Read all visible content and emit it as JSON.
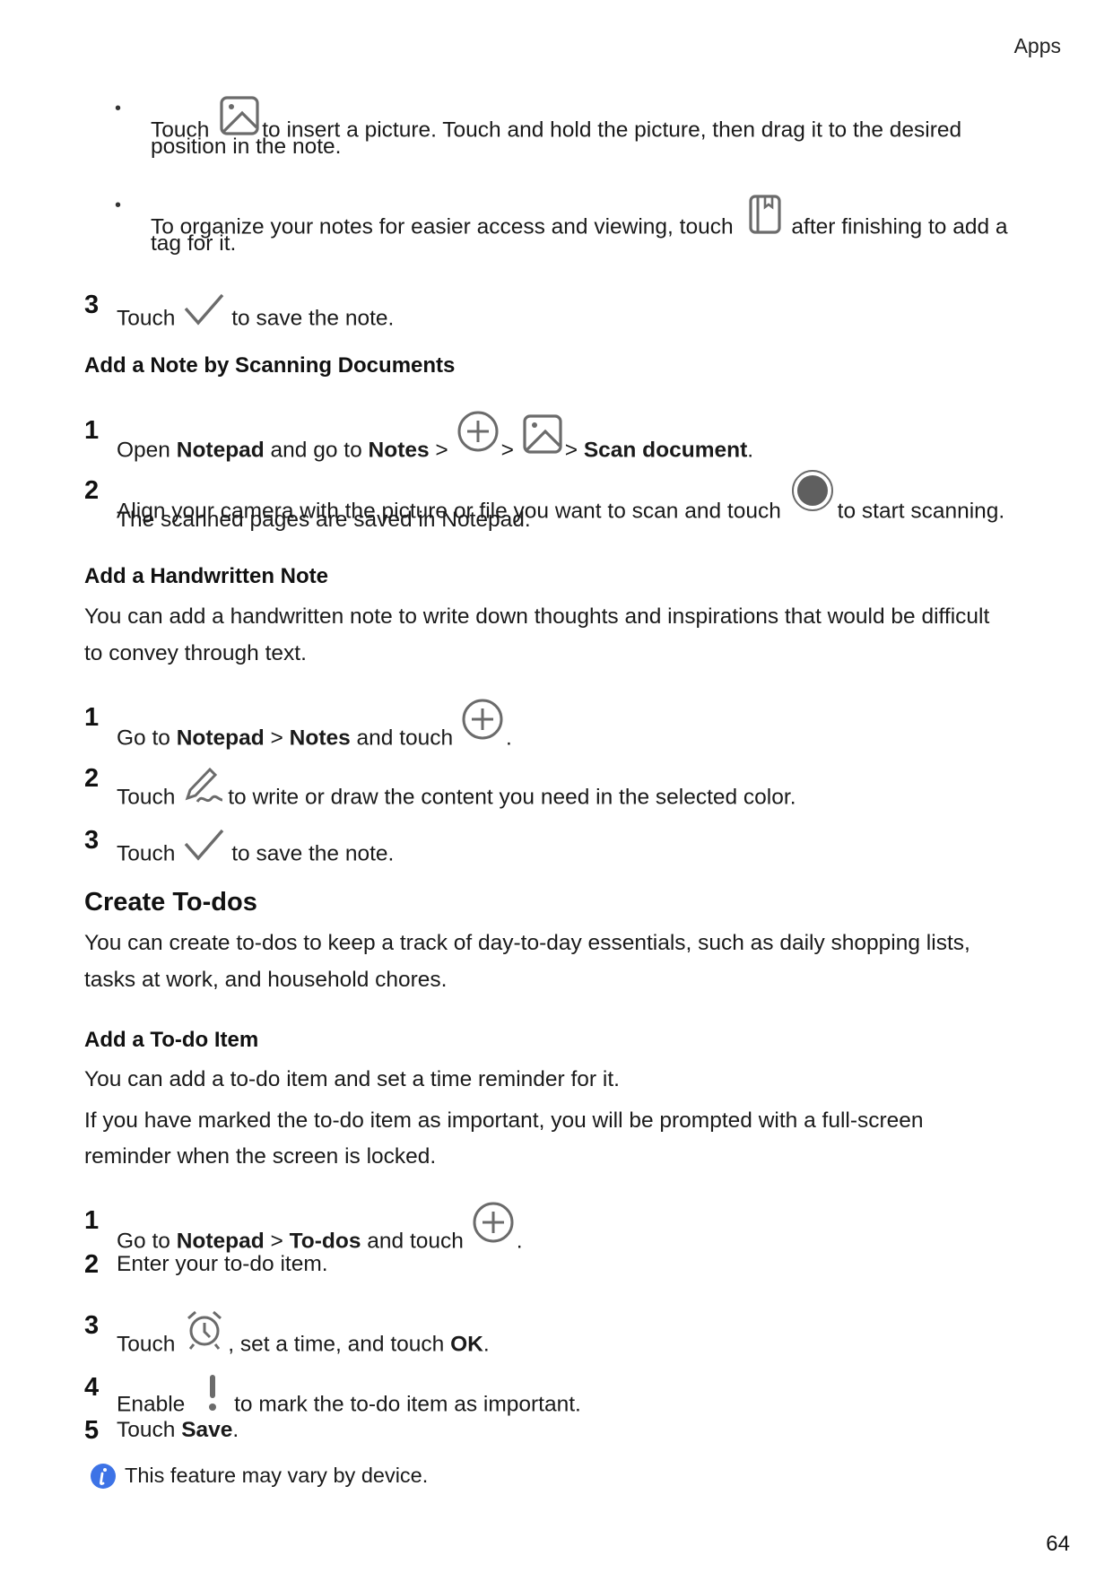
{
  "header": {
    "section": "Apps"
  },
  "footer": {
    "page_number": "64"
  },
  "colors": {
    "icon_gray": "#6b6b6b",
    "info_blue": "#3d73e6",
    "text": "#1a1a1a"
  },
  "bullets": [
    {
      "before": "Touch",
      "icon": "picture-icon",
      "after": "to insert a picture. Touch and hold the picture, then drag it to the desired",
      "line2": "position in the note."
    },
    {
      "before": "To organize your notes for easier access and viewing, touch",
      "icon": "tag-bookmark-icon",
      "after": "after finishing to add a",
      "line2": "tag for it."
    }
  ],
  "step_save_top": {
    "num": "3",
    "before": "Touch",
    "icon": "checkmark-icon",
    "after": "to save the note."
  },
  "scan": {
    "heading": "Add a Note by Scanning Documents",
    "step1": {
      "num": "1",
      "t1": "Open ",
      "b1": "Notepad",
      "t2": " and go to ",
      "b2": "Notes",
      "t3": " >",
      "t4": ">",
      "t5": "> ",
      "b3": "Scan document",
      "t6": "."
    },
    "step2": {
      "num": "2",
      "before": "Align your camera with the picture or file you want to scan and touch",
      "icon": "shutter-icon",
      "after": "to start scanning.",
      "line2": "The scanned pages are saved in Notepad."
    }
  },
  "handwritten": {
    "heading": "Add a Handwritten Note",
    "para_line1": "You can add a handwritten note to write down thoughts and inspirations that would be difficult",
    "para_line2": "to convey through text.",
    "step1": {
      "num": "1",
      "t1": "Go to ",
      "b1": "Notepad",
      "t2": " > ",
      "b2": "Notes",
      "t3": " and touch",
      "t4": "."
    },
    "step2": {
      "num": "2",
      "before": "Touch",
      "icon": "handwriting-pen-icon",
      "after": "to write or draw the content you need in the selected color."
    },
    "step3": {
      "num": "3",
      "before": "Touch",
      "icon": "checkmark-icon",
      "after": "to save the note."
    }
  },
  "todos": {
    "heading": "Create To-dos",
    "para_line1": "You can create to-dos to keep a track of day-to-day essentials, such as daily shopping lists,",
    "para_line2": "tasks at work, and household chores.",
    "sub_heading": "Add a To-do Item",
    "para2": "You can add a to-do item and set a time reminder for it.",
    "para3_line1": "If you have marked the to-do item as important, you will be prompted with a full-screen",
    "para3_line2": "reminder when the screen is locked.",
    "step1": {
      "num": "1",
      "t1": "Go to ",
      "b1": "Notepad",
      "t2": " > ",
      "b2": "To-dos",
      "t3": " and touch",
      "t4": "."
    },
    "step2": {
      "num": "2",
      "text": "Enter your to-do item."
    },
    "step3": {
      "num": "3",
      "before": "Touch",
      "icon": "alarm-clock-icon",
      "after": ", set a time, and touch ",
      "bold": "OK",
      "end": "."
    },
    "step4": {
      "num": "4",
      "before": "Enable",
      "icon": "exclamation-icon",
      "after": "to mark the to-do item as important."
    },
    "step5": {
      "num": "5",
      "before": "Touch ",
      "bold": "Save",
      "end": "."
    },
    "note": "This feature may vary by device."
  }
}
